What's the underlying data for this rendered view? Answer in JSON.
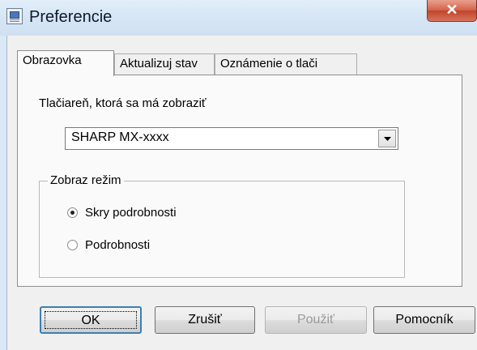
{
  "window": {
    "title": "Preferencie",
    "close_glyph": "✕"
  },
  "tabs": [
    {
      "label": "Obrazovka",
      "active": true
    },
    {
      "label": "Aktualizuj stav",
      "active": false
    },
    {
      "label": "Oznámenie o tlači",
      "active": false
    }
  ],
  "printer": {
    "label": "Tlačiareň, ktorá sa má zobraziť",
    "selected": "SHARP MX-xxxx"
  },
  "display_mode": {
    "group_label": "Zobraz režim",
    "options": [
      {
        "label": "Skry podrobnosti",
        "checked": true
      },
      {
        "label": "Podrobnosti",
        "checked": false
      }
    ]
  },
  "buttons": {
    "ok": "OK",
    "cancel": "Zrušiť",
    "apply": "Použiť",
    "help": "Pomocník"
  },
  "icons": {
    "app": "printer-preferences-icon",
    "close": "close-icon",
    "dropdown": "chevron-down-icon"
  },
  "colors": {
    "titlebar": "#d5e5f5",
    "close_button": "#c9533a",
    "dialog_bg": "#f0f0f0",
    "default_button_border": "#3c7fb1"
  }
}
